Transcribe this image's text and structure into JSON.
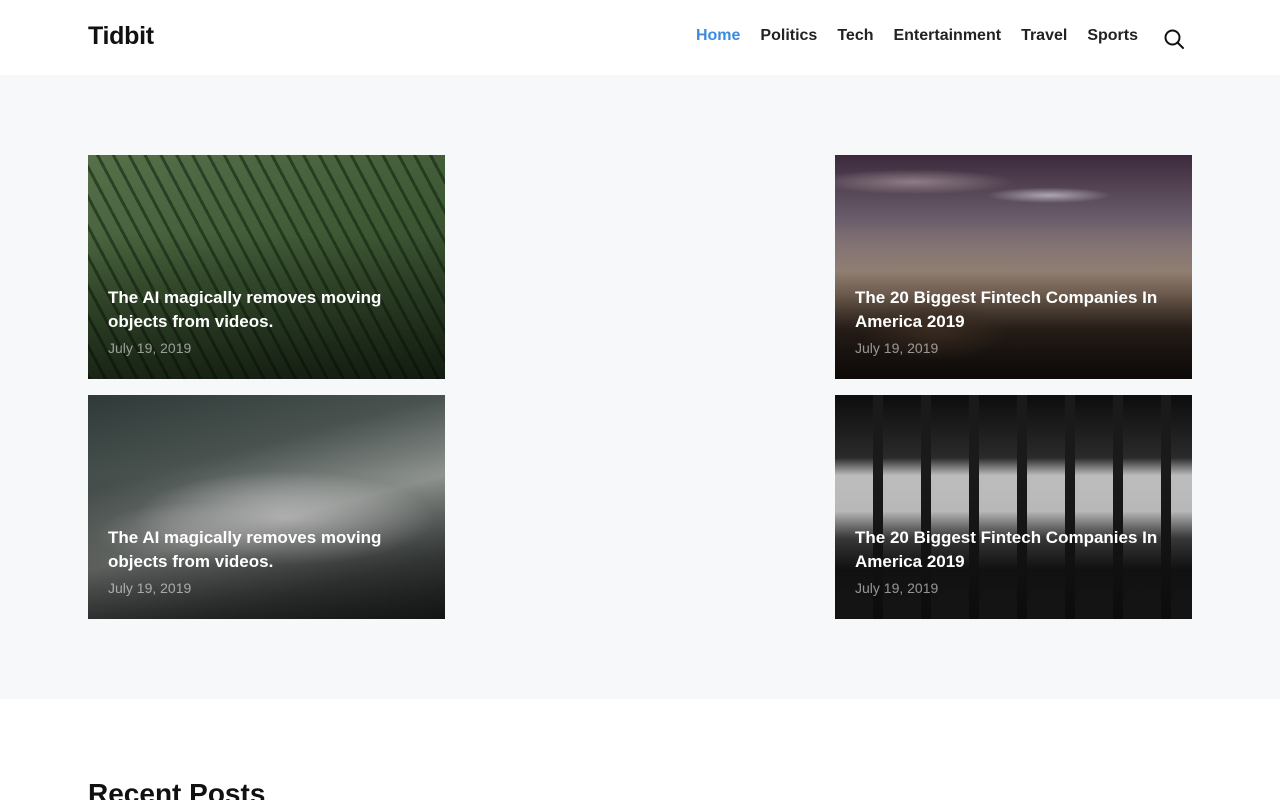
{
  "header": {
    "logo": "Tidbit",
    "nav": [
      {
        "label": "Home",
        "active": true
      },
      {
        "label": "Politics",
        "active": false
      },
      {
        "label": "Tech",
        "active": false
      },
      {
        "label": "Entertainment",
        "active": false
      },
      {
        "label": "Travel",
        "active": false
      },
      {
        "label": "Sports",
        "active": false
      }
    ],
    "search_icon": "search-icon",
    "accent_color": "#3b8ce0"
  },
  "featured": [
    {
      "title": "The AI magically removes moving objects from videos.",
      "date": "July 19, 2019",
      "image": "terraced green field"
    },
    {
      "title": "The 20 Biggest Fintech Companies In America 2019",
      "date": "July 19, 2019",
      "image": "person on rocky hilltop at dusk"
    },
    {
      "title": "The AI magically removes moving objects from videos.",
      "date": "July 19, 2019",
      "image": "misty forest mountain"
    },
    {
      "title": "The 20 Biggest Fintech Companies In America 2019",
      "date": "July 19, 2019",
      "image": "black and white subway station"
    }
  ],
  "recent": {
    "heading": "Recent Posts"
  }
}
